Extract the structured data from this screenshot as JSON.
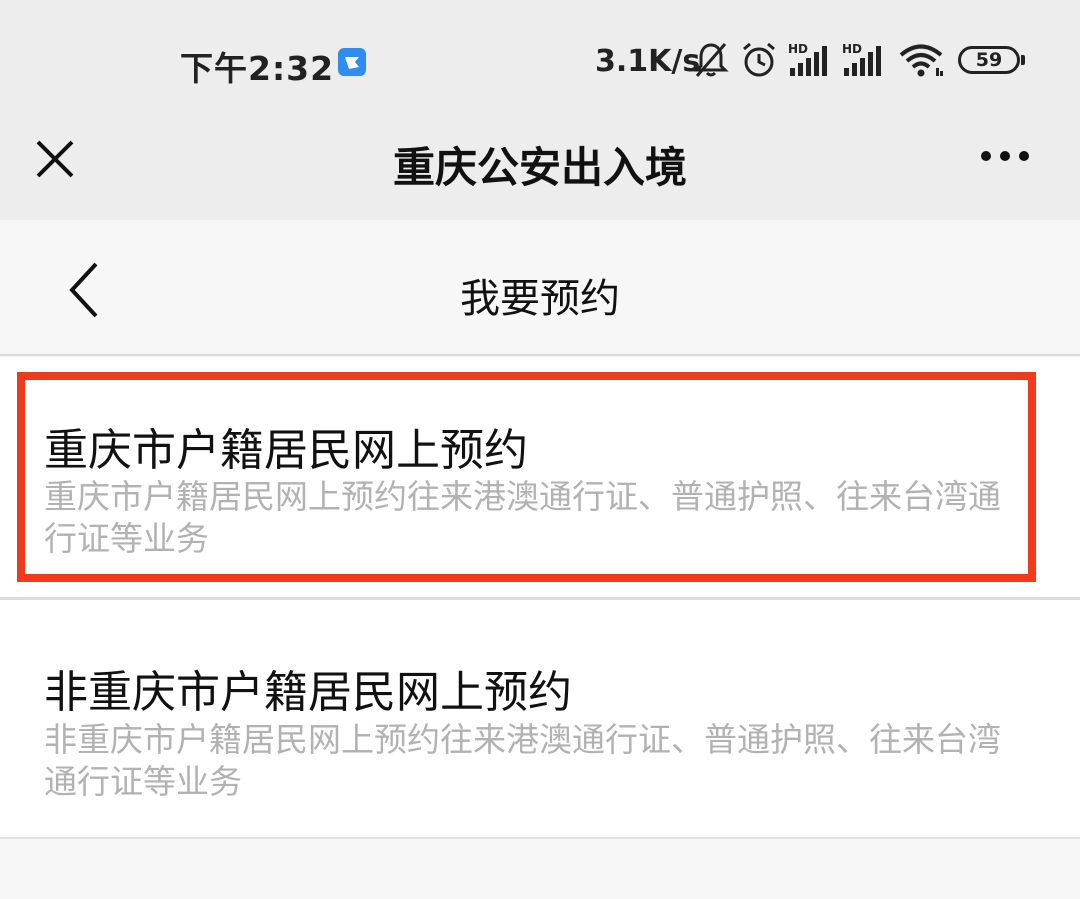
{
  "status_bar": {
    "time": "下午2:32",
    "network_speed": "3.1K/s",
    "battery_level": "59",
    "icons": [
      "app-notification-icon",
      "mute-bell-icon",
      "alarm-clock-icon",
      "hd-signal-icon",
      "hd-signal-icon",
      "wifi-icon",
      "battery-icon"
    ]
  },
  "title_bar": {
    "title": "重庆公安出入境",
    "close_icon": "close-icon",
    "more_icon": "more-icon"
  },
  "page_header": {
    "title": "我要预约",
    "back_icon": "chevron-left-icon"
  },
  "list": {
    "items": [
      {
        "title": "重庆市户籍居民网上预约",
        "description": "重庆市户籍居民网上预约往来港澳通行证、普通护照、往来台湾通行证等业务",
        "highlighted": true
      },
      {
        "title": "非重庆市户籍居民网上预约",
        "description": "非重庆市户籍居民网上预约往来港澳通行证、普通护照、往来台湾通行证等业务",
        "highlighted": false
      }
    ]
  },
  "colors": {
    "highlight_border": "#f03a1c",
    "title_bar_bg": "#ededed",
    "description_text": "#b2b2b2"
  }
}
